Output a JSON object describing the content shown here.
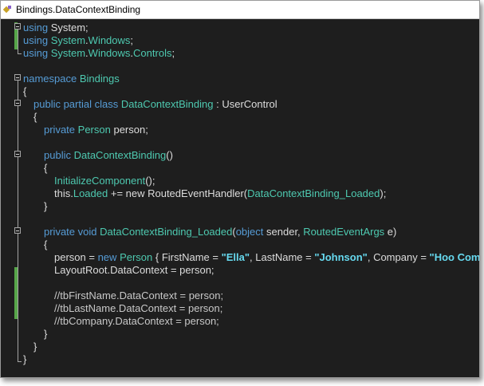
{
  "window": {
    "tab_title": "Bindings.DataContextBinding",
    "tab_icon": "class-icon"
  },
  "colors": {
    "background": "#1e1e1e",
    "keyword": "#569cd6",
    "type": "#4ec9b0",
    "plain": "#dcdcdc",
    "string": "#66d9ef",
    "change_bar": "#57a64a"
  },
  "code_lines": [
    {
      "indent": 0,
      "tokens": [
        [
          "kw",
          "using"
        ],
        [
          "pl",
          " System;"
        ]
      ]
    },
    {
      "indent": 0,
      "tokens": [
        [
          "kw",
          "using"
        ],
        [
          "pl",
          " "
        ],
        [
          "ty",
          "System"
        ],
        [
          "pl",
          "."
        ],
        [
          "ty",
          "Windows"
        ],
        [
          "pl",
          ";"
        ]
      ]
    },
    {
      "indent": 0,
      "tokens": [
        [
          "kw",
          "using"
        ],
        [
          "pl",
          " "
        ],
        [
          "ty",
          "System"
        ],
        [
          "pl",
          "."
        ],
        [
          "ty",
          "Windows"
        ],
        [
          "pl",
          "."
        ],
        [
          "ty",
          "Controls"
        ],
        [
          "pl",
          ";"
        ]
      ]
    },
    {
      "indent": 0,
      "tokens": []
    },
    {
      "indent": 0,
      "tokens": [
        [
          "kw",
          "namespace"
        ],
        [
          "pl",
          " "
        ],
        [
          "ty",
          "Bindings"
        ]
      ]
    },
    {
      "indent": 0,
      "tokens": [
        [
          "pl",
          "{"
        ]
      ]
    },
    {
      "indent": 1,
      "tokens": [
        [
          "kw",
          "public partial class"
        ],
        [
          "pl",
          " "
        ],
        [
          "ty",
          "DataContextBinding"
        ],
        [
          "pl",
          " : UserControl"
        ]
      ]
    },
    {
      "indent": 1,
      "tokens": [
        [
          "pl",
          "{"
        ]
      ]
    },
    {
      "indent": 2,
      "tokens": [
        [
          "kw",
          "private"
        ],
        [
          "pl",
          " "
        ],
        [
          "ty",
          "Person"
        ],
        [
          "pl",
          " person;"
        ]
      ]
    },
    {
      "indent": 0,
      "tokens": []
    },
    {
      "indent": 2,
      "tokens": [
        [
          "kw",
          "public"
        ],
        [
          "pl",
          " "
        ],
        [
          "ty",
          "DataContextBinding"
        ],
        [
          "pl",
          "()"
        ]
      ]
    },
    {
      "indent": 2,
      "tokens": [
        [
          "pl",
          "{"
        ]
      ]
    },
    {
      "indent": 3,
      "tokens": [
        [
          "ty",
          "InitializeComponent"
        ],
        [
          "pl",
          "();"
        ]
      ]
    },
    {
      "indent": 3,
      "tokens": [
        [
          "pl",
          "this."
        ],
        [
          "ty",
          "Loaded"
        ],
        [
          "pl",
          " += new RoutedEventHandler("
        ],
        [
          "ty",
          "DataContextBinding_Loaded"
        ],
        [
          "pl",
          ");"
        ]
      ]
    },
    {
      "indent": 2,
      "tokens": [
        [
          "pl",
          "}"
        ]
      ]
    },
    {
      "indent": 0,
      "tokens": []
    },
    {
      "indent": 2,
      "tokens": [
        [
          "kw",
          "private void"
        ],
        [
          "pl",
          " "
        ],
        [
          "ty",
          "DataContextBinding_Loaded"
        ],
        [
          "pl",
          "("
        ],
        [
          "kw",
          "object"
        ],
        [
          "pl",
          " sender, "
        ],
        [
          "ty",
          "RoutedEventArgs"
        ],
        [
          "pl",
          " e)"
        ]
      ]
    },
    {
      "indent": 2,
      "tokens": [
        [
          "pl",
          "{"
        ]
      ]
    },
    {
      "indent": 3,
      "tokens": [
        [
          "pl",
          "person = "
        ],
        [
          "kw",
          "new"
        ],
        [
          "pl",
          " "
        ],
        [
          "ty",
          "Person"
        ],
        [
          "pl",
          " { FirstName = "
        ],
        [
          "st",
          "\"Ella\""
        ],
        [
          "pl",
          ", LastName = "
        ],
        [
          "st",
          "\"Johnson\""
        ],
        [
          "pl",
          ", Company = "
        ],
        [
          "st",
          "\"Hoo Company\""
        ],
        [
          "pl",
          " };"
        ]
      ]
    },
    {
      "indent": 3,
      "tokens": [
        [
          "pl",
          "LayoutRoot.DataContext = person;"
        ]
      ]
    },
    {
      "indent": 0,
      "tokens": []
    },
    {
      "indent": 3,
      "tokens": [
        [
          "cm",
          "//tbFirstName.DataContext = person;"
        ]
      ]
    },
    {
      "indent": 3,
      "tokens": [
        [
          "cm",
          "//tbLastName.DataContext = person;"
        ]
      ]
    },
    {
      "indent": 3,
      "tokens": [
        [
          "cm",
          "//tbCompany.DataContext = person;"
        ]
      ]
    },
    {
      "indent": 2,
      "tokens": [
        [
          "pl",
          "}"
        ]
      ]
    },
    {
      "indent": 1,
      "tokens": [
        [
          "pl",
          "}"
        ]
      ]
    },
    {
      "indent": 0,
      "tokens": [
        [
          "pl",
          "}"
        ]
      ]
    }
  ]
}
